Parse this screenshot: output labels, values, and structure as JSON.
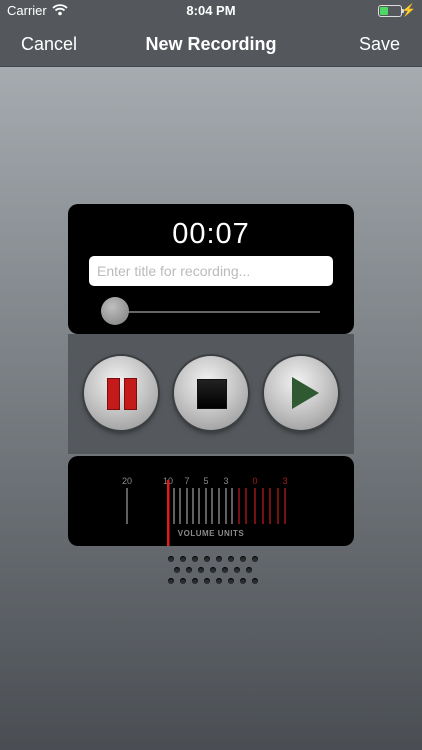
{
  "status_bar": {
    "carrier": "Carrier",
    "time": "8:04 PM",
    "wifi_icon": "wifi-icon",
    "battery_icon": "battery-icon",
    "charging_icon": "bolt-icon",
    "battery_level": 0.3
  },
  "nav": {
    "cancel_label": "Cancel",
    "title": "New Recording",
    "save_label": "Save"
  },
  "recorder": {
    "elapsed": "00:07",
    "title_placeholder": "Enter title for recording...",
    "title_value": "",
    "slider_position": 0.0,
    "buttons": {
      "pause": "pause-icon",
      "stop": "stop-icon",
      "play": "play-icon"
    }
  },
  "meter": {
    "scale_labels": [
      "20",
      "10",
      "7",
      "5",
      "3",
      "0",
      "3"
    ],
    "caption": "VOLUME UNITS",
    "needle_value": "10",
    "colors": {
      "scale": "#8a8a8a",
      "red_zone": "#a51b1b",
      "needle": "#e01b1b"
    }
  },
  "colors": {
    "nav_background": "#54585d",
    "battery_fill": "#4cd964",
    "pause_red": "#c51a1a",
    "play_green": "#2f5a31"
  }
}
